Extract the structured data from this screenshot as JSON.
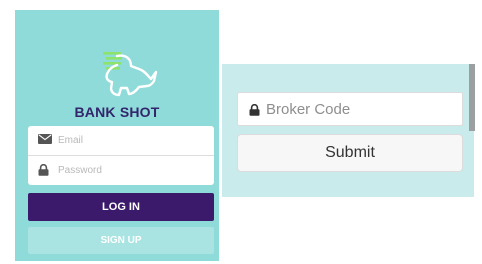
{
  "login": {
    "brand": "BANK SHOT",
    "email_placeholder": "Email",
    "password_placeholder": "Password",
    "login_label": "LOG IN",
    "signup_label": "SIGN UP",
    "logo_icon": "rhino-logo-icon",
    "colors": {
      "panel_bg": "#8fdbd9",
      "brand_text": "#33256b",
      "login_button": "#3b1a6b",
      "signup_button": "#a9e4e3"
    }
  },
  "broker": {
    "code_placeholder": "Broker Code",
    "submit_label": "Submit",
    "colors": {
      "panel_bg": "#c9ebeb",
      "submit_button": "#f7f7f7"
    }
  }
}
